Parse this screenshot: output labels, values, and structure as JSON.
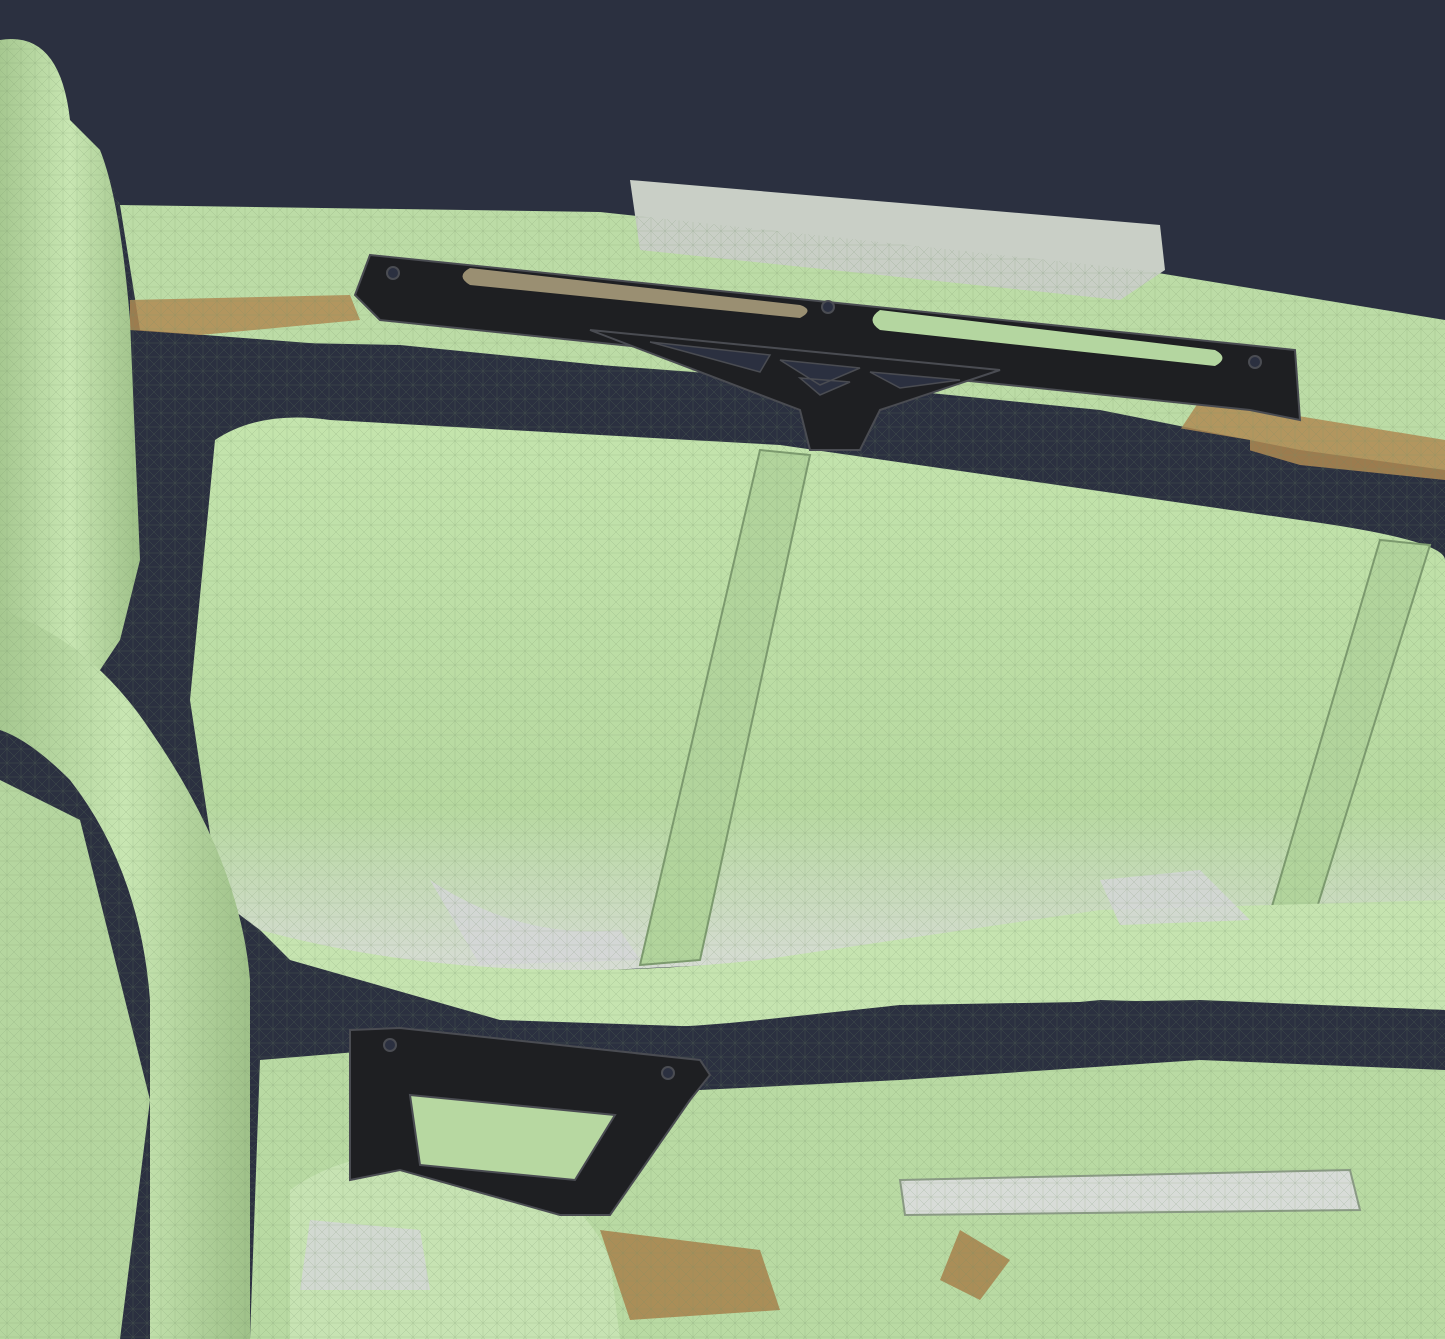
{
  "viewport": {
    "background": "#2b3040",
    "mesh_fill": "#bfe0a8",
    "mesh_fill_shadow": "#9fc48a",
    "mesh_wire": "#5d7a52",
    "mesh_worn": "#d4d6d8",
    "rust": "#b08a52",
    "part_fill": "#1e1f22",
    "part_edge": "#4a4c52"
  },
  "objects": [
    {
      "name": "scanned-mesh",
      "kind": "3d-scan"
    },
    {
      "name": "upper-mounting-bracket",
      "kind": "cad-part",
      "color": "#1e1f22"
    },
    {
      "name": "lower-mounting-bracket",
      "kind": "cad-part",
      "color": "#1e1f22"
    }
  ]
}
